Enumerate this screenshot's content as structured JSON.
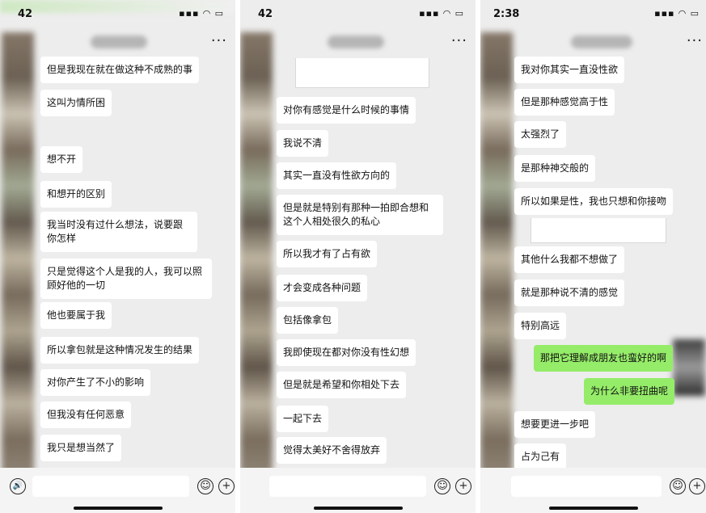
{
  "panels": [
    {
      "status_time": "42",
      "status_icons": "▪▪▪ ◠ ▭",
      "more": "···",
      "messages": [
        {
          "text": "但是我现在就在做这种不成熟的事",
          "side": "left"
        },
        {
          "text": "这叫为情所困",
          "side": "left"
        },
        {
          "text": "想不开",
          "side": "left"
        },
        {
          "text": "和想开的区别",
          "side": "left"
        },
        {
          "text": "我当时没有过什么想法，说要跟你怎样",
          "side": "left"
        },
        {
          "text": "只是觉得这个人是我的人，我可以照顾好他的一切",
          "side": "left"
        },
        {
          "text": "他也要属于我",
          "side": "left"
        },
        {
          "text": "所以拿包就是这种情况发生的结果",
          "side": "left"
        },
        {
          "text": "对你产生了不小的影响",
          "side": "left"
        },
        {
          "text": "但我没有任何恶意",
          "side": "left"
        },
        {
          "text": "我只是想当然了",
          "side": "left"
        }
      ],
      "voice_icon": "🔊",
      "emoji_icon": "☺",
      "plus_icon": "+"
    },
    {
      "status_time": "42",
      "status_icons": "▪▪▪ ◠ ▭",
      "more": "···",
      "messages": [
        {
          "text": "对你有感觉是什么时候的事情",
          "side": "left"
        },
        {
          "text": "我说不清",
          "side": "left"
        },
        {
          "text": "其实一直没有性欲方向的",
          "side": "left"
        },
        {
          "text": "但是就是特别有那种一拍即合想和这个人相处很久的私心",
          "side": "left"
        },
        {
          "text": "所以我才有了占有欲",
          "side": "left"
        },
        {
          "text": "才会变成各种问题",
          "side": "left"
        },
        {
          "text": "包括像拿包",
          "side": "left"
        },
        {
          "text": "我即使现在都对你没有性幻想",
          "side": "left"
        },
        {
          "text": "但是就是希望和你相处下去",
          "side": "left"
        },
        {
          "text": "一起下去",
          "side": "left"
        },
        {
          "text": "觉得太美好不舍得放弃",
          "side": "left"
        }
      ],
      "emoji_icon": "☺",
      "plus_icon": "+"
    },
    {
      "status_time": "2:38",
      "status_icons": "▪▪▪ ◠ ▭",
      "more": "···",
      "messages": [
        {
          "text": "我对你其实一直没性欲",
          "side": "left"
        },
        {
          "text": "但是那种感觉高于性",
          "side": "left"
        },
        {
          "text": "太强烈了",
          "side": "left"
        },
        {
          "text": "是那种神交般的",
          "side": "left"
        },
        {
          "text": "所以如果是性，我也只想和你接吻",
          "side": "left"
        },
        {
          "text": "其他什么我都不想做了",
          "side": "left"
        },
        {
          "text": "就是那种说不清的感觉",
          "side": "left"
        },
        {
          "text": "特别高远",
          "side": "left"
        },
        {
          "text": "那把它理解成朋友也蛮好的啊",
          "side": "right"
        },
        {
          "text": "为什么非要扭曲呢",
          "side": "right"
        },
        {
          "text": "想要更进一步吧",
          "side": "left"
        },
        {
          "text": "占为己有",
          "side": "left"
        }
      ],
      "emoji_icon": "☺",
      "plus_icon": "+"
    }
  ]
}
